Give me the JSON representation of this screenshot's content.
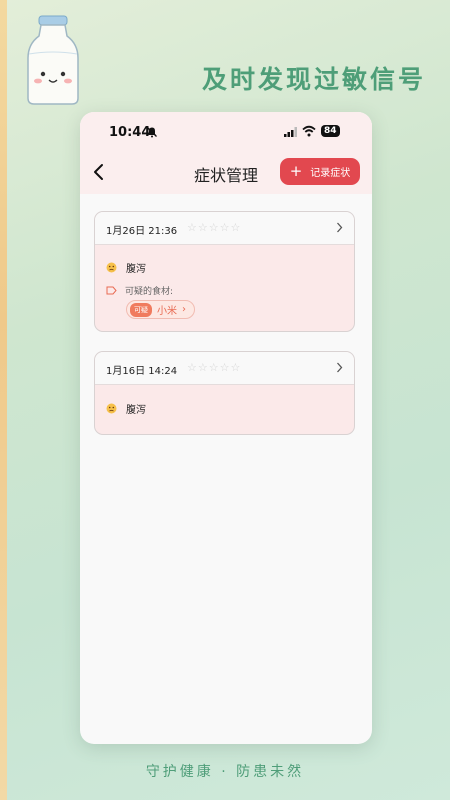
{
  "promo": {
    "headline": "及时发现过敏信号",
    "slogan": "守护健康 · 防患未然"
  },
  "status_bar": {
    "time": "10:44",
    "battery": "84"
  },
  "nav": {
    "title": "症状管理",
    "record_button": "记录症状",
    "record_icon": "+"
  },
  "records": [
    {
      "date": "1月26日 21:36",
      "rating": 0,
      "symptom": "腹泻",
      "foods_label": "可疑的食材:",
      "foods": [
        {
          "badge": "可疑",
          "name": "小米",
          "arrow": "›"
        }
      ]
    },
    {
      "date": "1月16日 14:24",
      "rating": 0,
      "symptom": "腹泻"
    }
  ],
  "icons": {
    "star": "☆"
  },
  "colors": {
    "accent": "#e2484f",
    "brand_green": "#4e9e78",
    "card_body": "#fbe9e9",
    "chip_text": "#e86a52"
  }
}
